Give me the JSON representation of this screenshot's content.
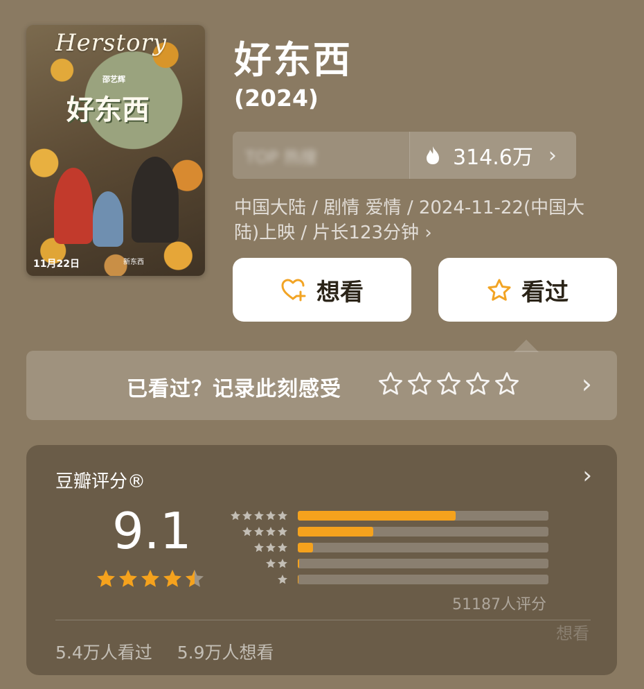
{
  "poster": {
    "english_title": "Herstory",
    "chinese_title": "好东西",
    "director": "邵艺辉",
    "release_date_text": "11月22日",
    "tagline": "新东西"
  },
  "movie": {
    "title": "好东西",
    "year": "(2024)"
  },
  "heat": {
    "blurred_text": "TOP 热搜",
    "value": "314.6万",
    "icon": "flame-icon"
  },
  "meta_text": "中国大陆 / 剧情 爱情 / 2024-11-22(中国大陆)上映 / 片长123分钟 ›",
  "buttons": {
    "want_label": "想看",
    "seen_label": "看过"
  },
  "record": {
    "label": "已看过？记录此刻感受",
    "star_count": 5
  },
  "rating": {
    "header": "豆瓣评分®",
    "score": "9.1",
    "score_value": 9.1,
    "stars": 4.5,
    "distribution": [
      {
        "stars": 5,
        "percent": 63
      },
      {
        "stars": 4,
        "percent": 30
      },
      {
        "stars": 3,
        "percent": 6
      },
      {
        "stars": 2,
        "percent": 0.6
      },
      {
        "stars": 1,
        "percent": 0.2
      }
    ],
    "count_text": "51187人评分",
    "watched_text": "5.4万人看过",
    "want_text": "5.9万人想看",
    "watermark": "想看"
  },
  "colors": {
    "background": "#8a7a62",
    "panel": "#6a5c48",
    "accent": "#f5a21d",
    "button": "#ffffff"
  }
}
